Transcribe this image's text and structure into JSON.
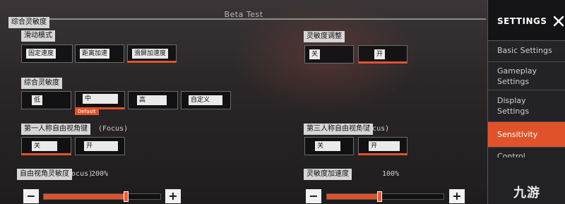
{
  "header": {
    "beta_label": "Beta Test"
  },
  "general_section": {
    "title": "综合灵敏度"
  },
  "scroll_mode": {
    "label": "滑动模式",
    "options": [
      "固定速度",
      "距离加速",
      "滑屏加速度"
    ],
    "selected": "滑屏加速度"
  },
  "sensitivity_adjust": {
    "label": "灵敏度调整",
    "options": [
      "关",
      "开"
    ],
    "selected": "开"
  },
  "overall_sensitivity": {
    "label": "综合灵敏度",
    "options": [
      "低",
      "中",
      "高",
      "自定义"
    ],
    "selected": "中",
    "default_tag": "Default"
  },
  "fp_freelook": {
    "label": "第一人称自由视角键",
    "suffix": "(Focus)",
    "options": [
      "关",
      "开"
    ],
    "selected": "关"
  },
  "tp_freelook": {
    "label": "第三人称自由视角键",
    "suffix": "(Focus)",
    "options": [
      "关",
      "开"
    ],
    "selected": "开"
  },
  "freelook_sensitivity": {
    "label": "自由视角灵敏度",
    "suffix": "(Focus)",
    "value_text": "200%",
    "value_fraction": 0.7,
    "minus": "−",
    "plus": "+"
  },
  "sensitivity_accel": {
    "label": "灵敏度加速度",
    "value_text": "100%",
    "value_fraction": 0.45,
    "minus": "−",
    "plus": "+"
  },
  "settings_panel": {
    "title": "SETTINGS",
    "close_icon": "close-icon",
    "items": [
      {
        "label": "Basic Settings"
      },
      {
        "label_line1": "Gameplay",
        "label_line2": "Settings"
      },
      {
        "label_line1": "Display",
        "label_line2": "Settings"
      },
      {
        "label": "Sensitivity"
      },
      {
        "label": "Control"
      }
    ],
    "active": "Sensitivity"
  },
  "watermark": {
    "text": "九游"
  },
  "colors": {
    "accent": "#e0532a",
    "panel_bg": "#141416",
    "label_bg": "#d6d6d6"
  }
}
